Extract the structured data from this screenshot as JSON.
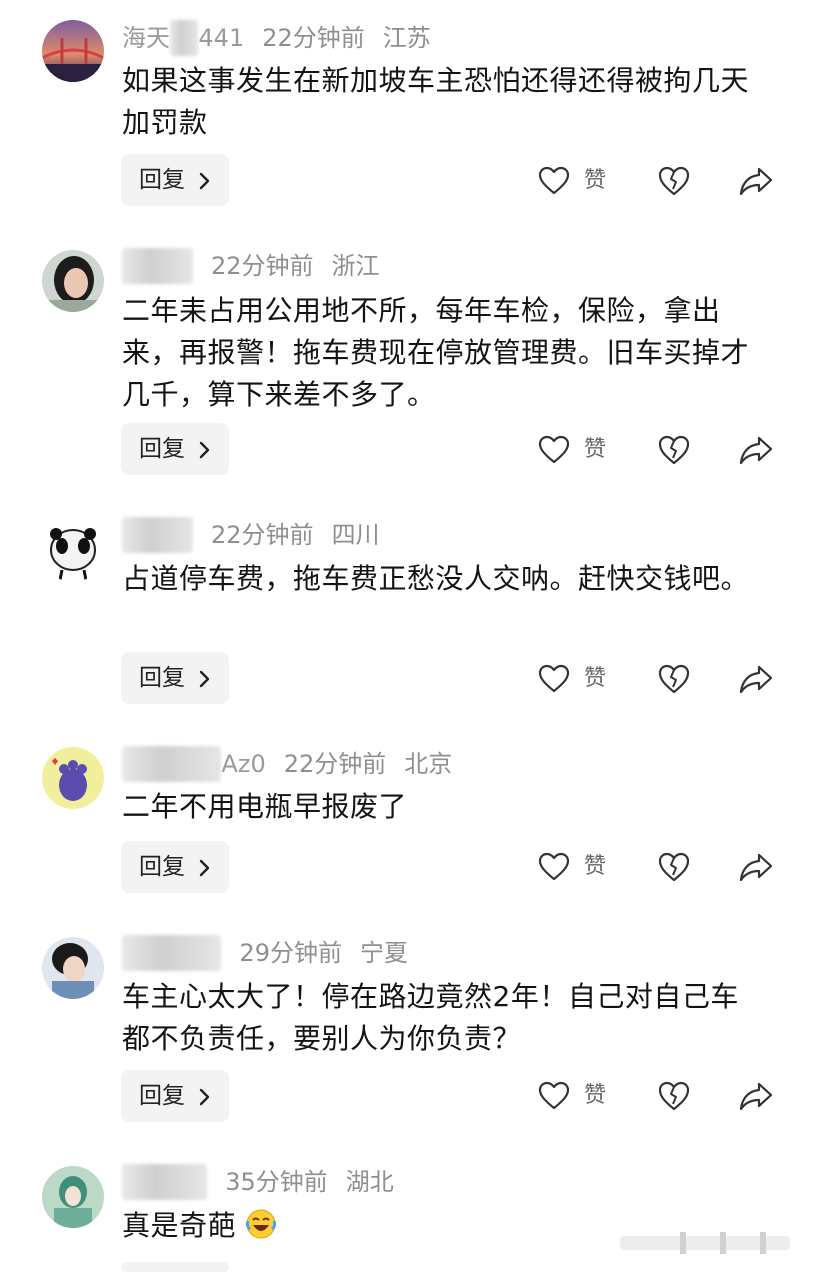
{
  "comments": [
    {
      "nick_visible": "海天",
      "nick_tail": "441",
      "time": "22分钟前",
      "region": "江苏",
      "text": "如果这事发生在新加坡车主恐怕还得还得被拘几天加罚款",
      "reply": "回复",
      "like": "赞"
    },
    {
      "nick_visible": "",
      "nick_tail": "",
      "time": "22分钟前",
      "region": "浙江",
      "text": "二年耒占用公用地不所，每年车检，保险，拿出来，再报警！拖车费现在停放管理费。旧车买掉才几千，算下来差不多了。",
      "reply": "回复",
      "like": "赞"
    },
    {
      "nick_visible": "",
      "nick_tail": "",
      "time": "22分钟前",
      "region": "四川",
      "text": "占道停车费，拖车费正愁没人交呐。赶快交钱吧。",
      "reply": "回复",
      "like": "赞"
    },
    {
      "nick_visible": "",
      "nick_tail": "Az0",
      "time": "22分钟前",
      "region": "北京",
      "text": "二年不用电瓶早报废了",
      "reply": "回复",
      "like": "赞"
    },
    {
      "nick_visible": "",
      "nick_tail": "",
      "time": "29分钟前",
      "region": "宁夏",
      "text": "车主心太大了！停在路边竟然2年！自己对自己车都不负责任，要别人为你负责？",
      "reply": "回复",
      "like": "赞"
    },
    {
      "nick_visible": "",
      "nick_tail": "",
      "time": "35分钟前",
      "region": "湖北",
      "text": "真是奇葩",
      "reply": "回复",
      "like": "赞"
    }
  ],
  "icons": {
    "like": "heart-outline-icon",
    "dislike": "broken-heart-icon",
    "share": "share-arrow-icon",
    "reply_chevron": "chevron-right-icon",
    "emoji": "laughing-crying-emoji-icon"
  },
  "colors": {
    "text": "#141414",
    "meta": "#8f8f8f",
    "reply_bg": "#f3f3f3",
    "icon": "#333333"
  }
}
